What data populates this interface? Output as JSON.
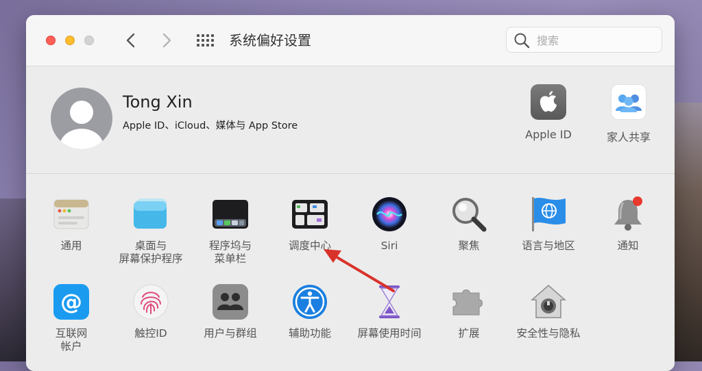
{
  "window": {
    "title": "系统偏好设置"
  },
  "search": {
    "placeholder": "搜索"
  },
  "account": {
    "name": "Tong Xin",
    "subtitle": "Apple ID、iCloud、媒体与 App Store",
    "items": [
      {
        "label": "Apple ID",
        "icon": "apple-logo-icon"
      },
      {
        "label": "家人共享",
        "icon": "family-icon"
      }
    ]
  },
  "prefs": {
    "row1": [
      {
        "label_1": "通用",
        "label_2": "",
        "icon": "general-icon"
      },
      {
        "label_1": "桌面与",
        "label_2": "屏幕保护程序",
        "icon": "desktop-icon"
      },
      {
        "label_1": "程序坞与",
        "label_2": "菜单栏",
        "icon": "dock-icon"
      },
      {
        "label_1": "调度中心",
        "label_2": "",
        "icon": "mission-control-icon"
      },
      {
        "label_1": "Siri",
        "label_2": "",
        "icon": "siri-icon"
      },
      {
        "label_1": "聚焦",
        "label_2": "",
        "icon": "spotlight-icon"
      },
      {
        "label_1": "语言与地区",
        "label_2": "",
        "icon": "globe-flag-icon"
      },
      {
        "label_1": "通知",
        "label_2": "",
        "icon": "bell-icon"
      }
    ],
    "row2": [
      {
        "label_1": "互联网",
        "label_2": "帐户",
        "icon": "internet-accounts-icon"
      },
      {
        "label_1": "触控ID",
        "label_2": "",
        "icon": "fingerprint-icon"
      },
      {
        "label_1": "用户与群组",
        "label_2": "",
        "icon": "users-icon"
      },
      {
        "label_1": "辅助功能",
        "label_2": "",
        "icon": "accessibility-icon"
      },
      {
        "label_1": "屏幕使用时间",
        "label_2": "",
        "icon": "hourglass-icon"
      },
      {
        "label_1": "扩展",
        "label_2": "",
        "icon": "puzzle-icon"
      },
      {
        "label_1": "安全性与隐私",
        "label_2": "",
        "icon": "house-lock-icon"
      }
    ]
  },
  "colors": {
    "accent": "#1d7cf2",
    "annotation_arrow": "#d9322b"
  }
}
